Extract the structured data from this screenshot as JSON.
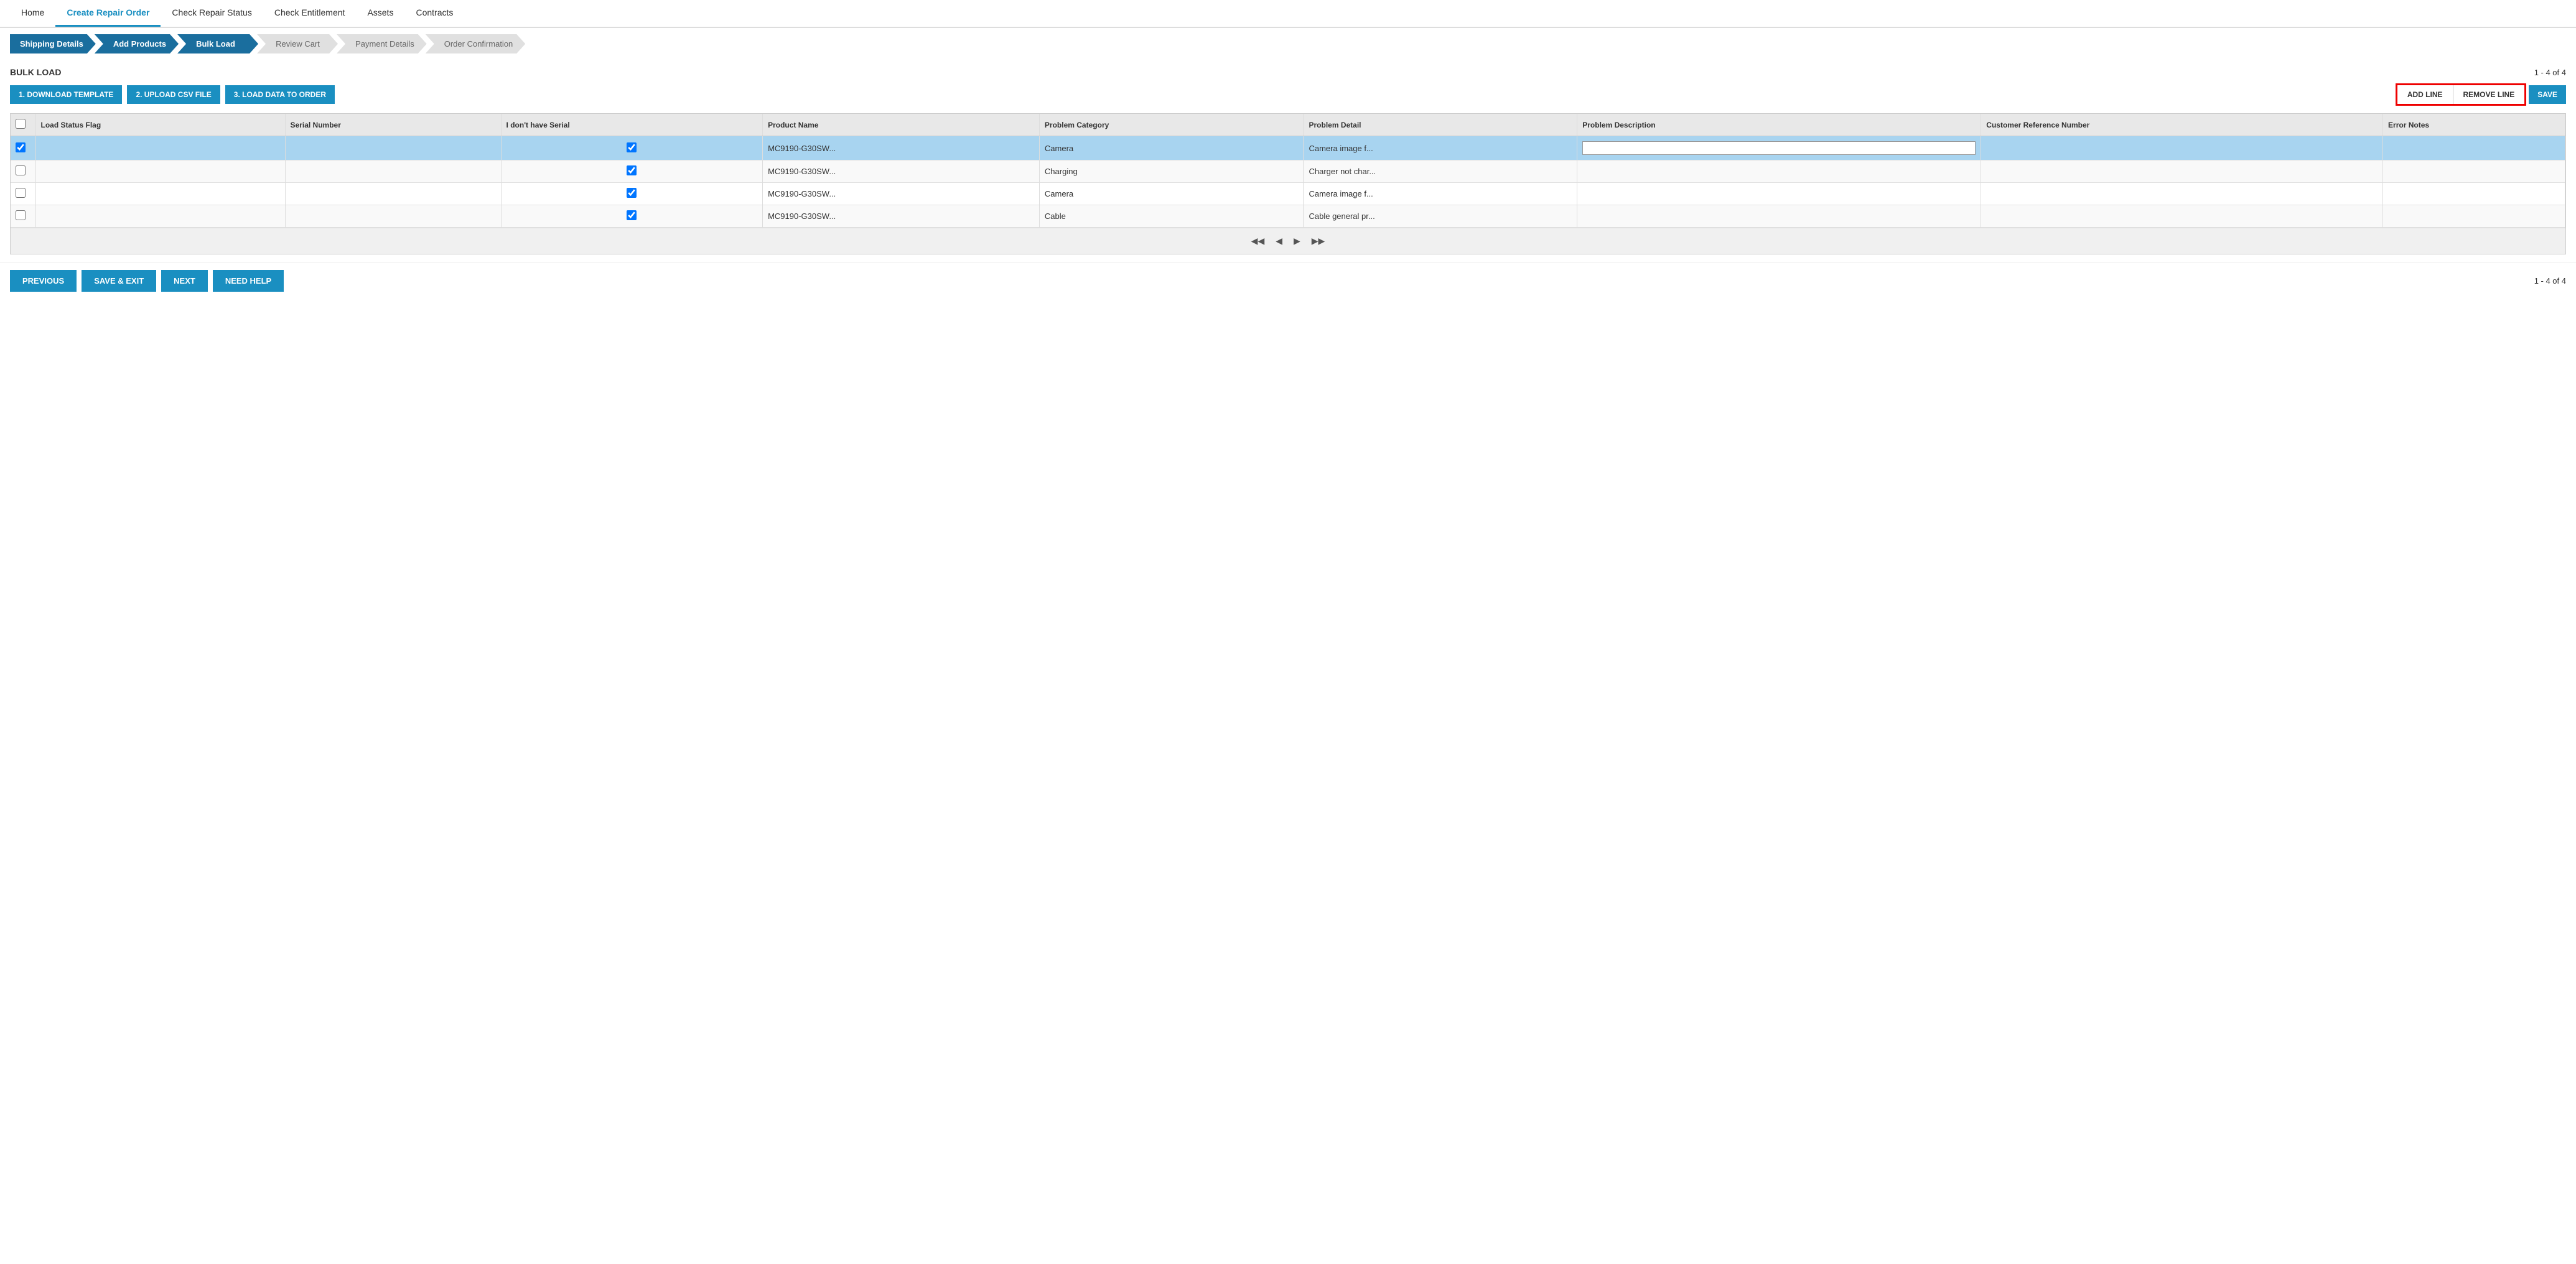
{
  "nav": {
    "items": [
      {
        "label": "Home",
        "active": false
      },
      {
        "label": "Create Repair Order",
        "active": true
      },
      {
        "label": "Check Repair Status",
        "active": false
      },
      {
        "label": "Check Entitlement",
        "active": false
      },
      {
        "label": "Assets",
        "active": false
      },
      {
        "label": "Contracts",
        "active": false
      }
    ]
  },
  "stepper": {
    "steps": [
      {
        "label": "Shipping Details",
        "active": true,
        "first": true
      },
      {
        "label": "Add Products",
        "active": true,
        "first": false
      },
      {
        "label": "Bulk Load",
        "active": true,
        "first": false
      },
      {
        "label": "Review Cart",
        "active": false,
        "first": false
      },
      {
        "label": "Payment Details",
        "active": false,
        "first": false
      },
      {
        "label": "Order Confirmation",
        "active": false,
        "first": false
      }
    ]
  },
  "bulk_load": {
    "title": "BULK LOAD",
    "pagination": "1 - 4 of 4",
    "pagination_bottom": "1 - 4 of 4"
  },
  "toolbar": {
    "btn1": "1. DOWNLOAD TEMPLATE",
    "btn2": "2. UPLOAD CSV FILE",
    "btn3": "3. LOAD DATA TO ORDER",
    "add_line": "ADD LINE",
    "remove_line": "REMOVE LINE",
    "save": "SAVE"
  },
  "table": {
    "columns": [
      "",
      "Load Status Flag",
      "Serial Number",
      "I don't have Serial",
      "Product Name",
      "Problem Category",
      "Problem Detail",
      "Problem Description",
      "Customer Reference Number",
      "Error Notes"
    ],
    "rows": [
      {
        "selected": true,
        "check": true,
        "load_status": "",
        "serial": "",
        "no_serial": true,
        "product": "MC9190-G30SW...",
        "category": "Camera",
        "detail": "Camera image f...",
        "description": "",
        "cust_ref": "",
        "error": ""
      },
      {
        "selected": false,
        "check": false,
        "load_status": "",
        "serial": "",
        "no_serial": true,
        "product": "MC9190-G30SW...",
        "category": "Charging",
        "detail": "Charger not char...",
        "description": "",
        "cust_ref": "",
        "error": ""
      },
      {
        "selected": false,
        "check": false,
        "load_status": "",
        "serial": "",
        "no_serial": true,
        "product": "MC9190-G30SW...",
        "category": "Camera",
        "detail": "Camera image f...",
        "description": "",
        "cust_ref": "",
        "error": ""
      },
      {
        "selected": false,
        "check": false,
        "load_status": "",
        "serial": "",
        "no_serial": true,
        "product": "MC9190-G30SW...",
        "category": "Cable",
        "detail": "Cable general pr...",
        "description": "",
        "cust_ref": "",
        "error": ""
      }
    ]
  },
  "bottom": {
    "previous": "PREVIOUS",
    "save_exit": "SAVE & EXIT",
    "next": "NEXT",
    "need_help": "NEED HELP"
  }
}
